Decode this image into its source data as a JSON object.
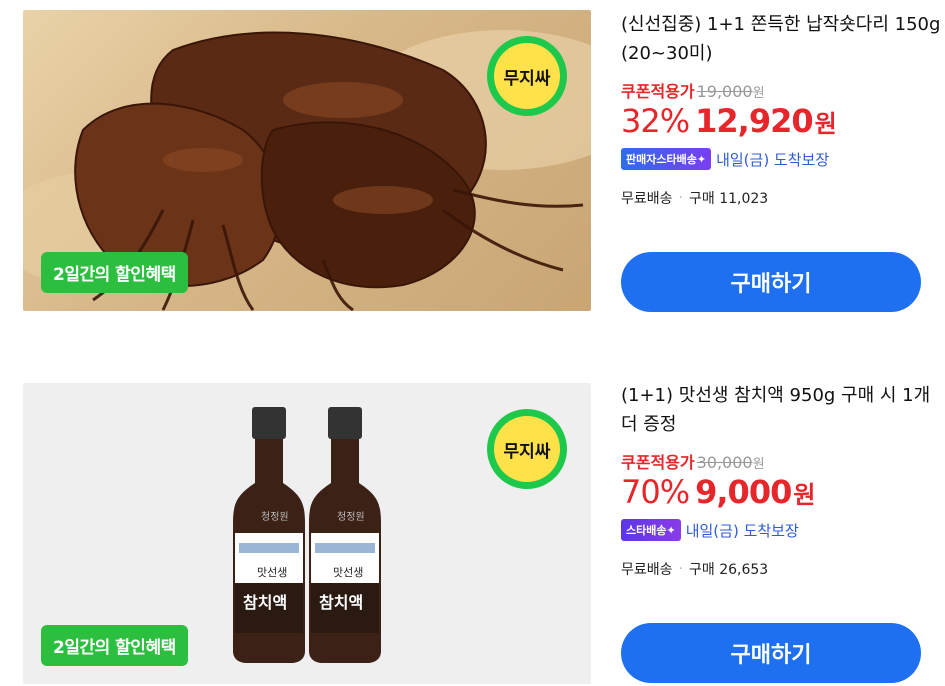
{
  "products": [
    {
      "title": "(신선집중) 1+1 쫀득한 납작숏다리 150g (20~30미)",
      "coupon_label": "쿠폰적용가",
      "original_price": "19,000",
      "original_won": "원",
      "discount_pct": "32%",
      "sale_price": "12,920",
      "sale_won": "원",
      "delivery_badge": "판매자스타배송✦",
      "delivery_text": "내일(금) 도착보장",
      "shipping": "무료배송",
      "purchase_count": "구매 11,023",
      "badge_text": "무지싸",
      "promo_tag": "2일간의 할인혜택",
      "buy_label": "구매하기"
    },
    {
      "title": "(1+1) 맛선생 참치액 950g 구매 시 1개 더 증정",
      "coupon_label": "쿠폰적용가",
      "original_price": "30,000",
      "original_won": "원",
      "discount_pct": "70%",
      "sale_price": "9,000",
      "sale_won": "원",
      "delivery_badge": "스타배송✦",
      "delivery_text": "내일(금) 도착보장",
      "shipping": "무료배송",
      "purchase_count": "구매 26,653",
      "badge_text": "무지싸",
      "promo_tag": "2일간의 할인혜택",
      "buy_label": "구매하기",
      "bottle_brand": "청정원",
      "bottle_name": "참치액",
      "bottle_sub": "맛선생"
    }
  ],
  "colors": {
    "accent": "#1e70f0",
    "sale": "#e5262b",
    "promo": "#2cbf3f",
    "delivery_text": "#2f5bd8"
  }
}
